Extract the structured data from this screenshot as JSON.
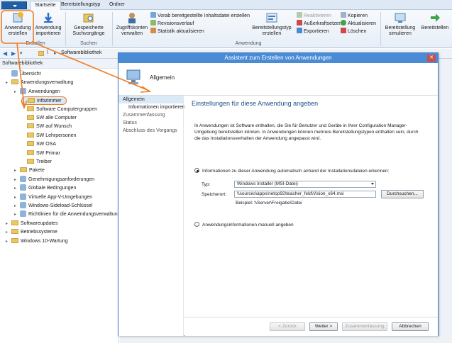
{
  "ribbon_tabs": [
    "Startseite",
    "Bereitstellungstyp",
    "Ordner"
  ],
  "ribbon": {
    "create_app": "Anwendung erstellen",
    "import_app": "Anwendung importieren",
    "saved_search": "Gespeicherte Suchvorgänge",
    "access_accounts": "Zugriffskonten verwalten",
    "small_col1": [
      "Vorab bereitgestellte Inhaltsdatei erstellen",
      "Revisionsverlauf",
      "Statistik aktualisieren"
    ],
    "create_deploy_type": "Bereitstellungstyp erstellen",
    "small_col2": [
      "Reaktivieren",
      "Außerkraftsetzen",
      "Exportieren"
    ],
    "small_col3": [
      "Kopieren",
      "Aktualisieren",
      "Löschen"
    ],
    "simulate": "Bereitstellung simulieren",
    "deploy": "Bereitstellen",
    "groups": [
      "Erstellen",
      "Suchen",
      "Anwendung"
    ]
  },
  "breadcrumb": {
    "root": "\\",
    "item": "Softwarebibliothek"
  },
  "leftpane": {
    "title": "Softwarebibliothek",
    "tree": [
      {
        "label": "Übersicht",
        "level": 1,
        "icon": "overview"
      },
      {
        "label": "Anwendungsverwaltung",
        "level": 1,
        "icon": "folder"
      },
      {
        "label": "Anwendungen",
        "level": 2,
        "icon": "apps"
      },
      {
        "label": "Infozimmer",
        "level": 3,
        "icon": "folder",
        "selected": true
      },
      {
        "label": "Software Computergruppen",
        "level": 3,
        "icon": "folder"
      },
      {
        "label": "SW alle Computer",
        "level": 3,
        "icon": "folder"
      },
      {
        "label": "SW auf Wunsch",
        "level": 3,
        "icon": "folder"
      },
      {
        "label": "SW Lehrpersonen",
        "level": 3,
        "icon": "folder"
      },
      {
        "label": "SW OSA",
        "level": 3,
        "icon": "folder"
      },
      {
        "label": "SW Primar",
        "level": 3,
        "icon": "folder"
      },
      {
        "label": "Treiber",
        "level": 3,
        "icon": "folder"
      },
      {
        "label": "Pakete",
        "level": 2,
        "icon": "folder"
      },
      {
        "label": "Genehmigungsanforderungen",
        "level": 2,
        "icon": "obj"
      },
      {
        "label": "Globale Bedingungen",
        "level": 2,
        "icon": "obj"
      },
      {
        "label": "Virtuelle App-V-Umgebungen",
        "level": 2,
        "icon": "obj"
      },
      {
        "label": "Windows-Sideload-Schlüssel",
        "level": 2,
        "icon": "obj"
      },
      {
        "label": "Richtlinien für die Anwendungsverwaltung",
        "level": 2,
        "icon": "obj"
      },
      {
        "label": "Softwareupdates",
        "level": 1,
        "icon": "folder"
      },
      {
        "label": "Betriebssysteme",
        "level": 1,
        "icon": "folder"
      },
      {
        "label": "Windows 10-Wartung",
        "level": 1,
        "icon": "folder"
      }
    ]
  },
  "wizard": {
    "title": "Assistent zum Erstellen von Anwendungen",
    "header": "Allgemein",
    "steps": [
      {
        "label": "Allgemein",
        "current": true,
        "sub": false
      },
      {
        "label": "Informationen importieren",
        "current": false,
        "sub": true
      },
      {
        "label": "Zusammenfassung",
        "current": false,
        "sub": false
      },
      {
        "label": "Status",
        "current": false,
        "sub": false
      },
      {
        "label": "Abschluss des Vorgangs",
        "current": false,
        "sub": false
      }
    ],
    "content_title": "Einstellungen für diese Anwendung angeben",
    "description": "In Anwendungen ist Software enthalten, die Sie für Benutzer und Geräte in Ihrer Configuration Manager-Umgebung bereitstellen können. In Anwendungen können mehrere Bereitstellungstypen enthalten sein, durch die das Installationsverhalten der Anwendung angepasst wird.",
    "radio_auto": "Informationen zu dieser Anwendung automatisch anhand der Installationsdateien erkennen:",
    "type_label": "Typ:",
    "type_value": "Windows Installer (MSI-Datei)",
    "location_label": "Speicherort:",
    "location_value": "\\\\sources\\apps\\netop92\\teacher_feld\\Vision_x64.msi",
    "browse": "Durchsuchen...",
    "example": "Beispiel: \\\\Server\\Freigabe\\Datei",
    "radio_manual": "Anwendungsinformationen manuell angeben",
    "buttons": {
      "back": "< Zurück",
      "next": "Weiter >",
      "summary": "Zusammenfassung",
      "cancel": "Abbrechen"
    }
  },
  "colors": {
    "accent": "#4a8bd6",
    "annotation": "#f07b22",
    "title_text": "#1c4f8c"
  }
}
